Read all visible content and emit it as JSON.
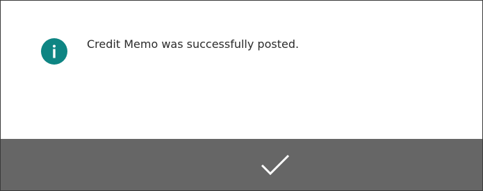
{
  "dialog": {
    "message": "Credit Memo was successfully posted.",
    "icon": "info-icon",
    "accent_color": "#0e8583",
    "ok_button_icon": "checkmark-icon",
    "action_bar_color": "#666666"
  }
}
